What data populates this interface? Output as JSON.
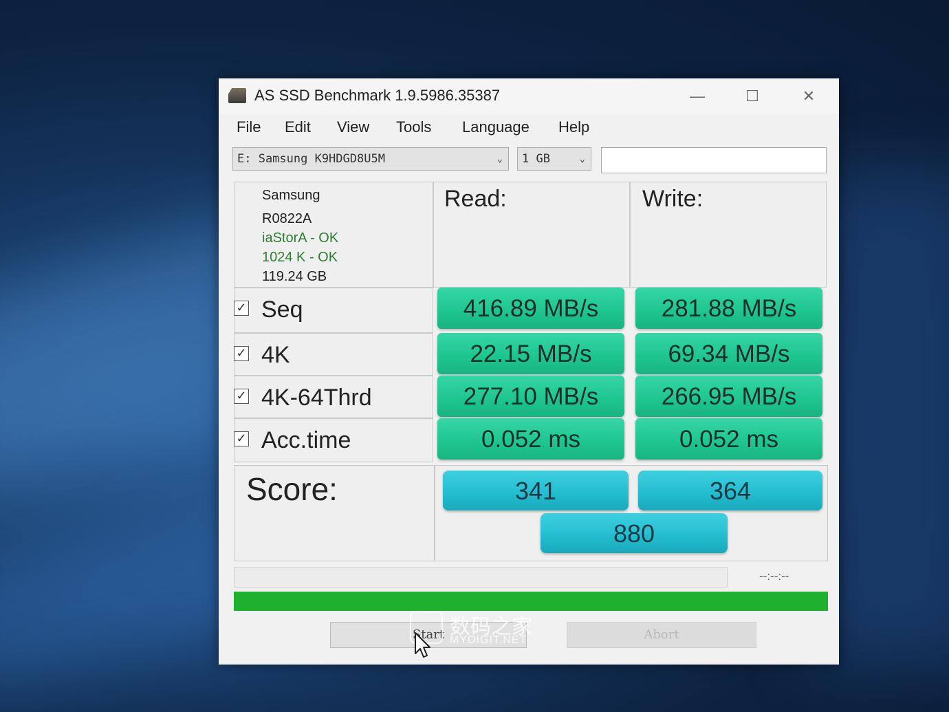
{
  "window": {
    "title": "AS SSD Benchmark 1.9.5986.35387",
    "minimize": "—",
    "maximize": "☐",
    "close": "✕"
  },
  "menu": [
    "File",
    "Edit",
    "View",
    "Tools",
    "Language",
    "Help"
  ],
  "drive_select": {
    "value": "E: Samsung K9HDGD8U5M"
  },
  "size_select": {
    "value": "1 GB"
  },
  "info": {
    "vendor": "Samsung",
    "firmware": "R0822A",
    "driver": "iaStorA - OK",
    "alignment": "1024 K - OK",
    "capacity": "119.24 GB"
  },
  "headers": {
    "read": "Read:",
    "write": "Write:"
  },
  "rows": [
    {
      "label": "Seq",
      "checked": true,
      "read": "416.89 MB/s",
      "write": "281.88 MB/s"
    },
    {
      "label": "4K",
      "checked": true,
      "read": "22.15 MB/s",
      "write": "69.34 MB/s"
    },
    {
      "label": "4K-64Thrd",
      "checked": true,
      "read": "277.10 MB/s",
      "write": "266.95 MB/s"
    },
    {
      "label": "Acc.time",
      "checked": true,
      "read": "0.052 ms",
      "write": "0.052 ms"
    }
  ],
  "score": {
    "label": "Score:",
    "read": "341",
    "write": "364",
    "total": "880"
  },
  "status": {
    "time": "--:--:--"
  },
  "progress": {
    "fraction": 1.0
  },
  "buttons": {
    "start": "Start",
    "abort": "Abort"
  },
  "watermark": {
    "cn": "数码之家",
    "en": "MYDIGIT.NET"
  },
  "colors": {
    "result": "#1fc690",
    "score": "#22bccf",
    "progress": "#1fb02d",
    "ok_text": "#2e7d32"
  }
}
